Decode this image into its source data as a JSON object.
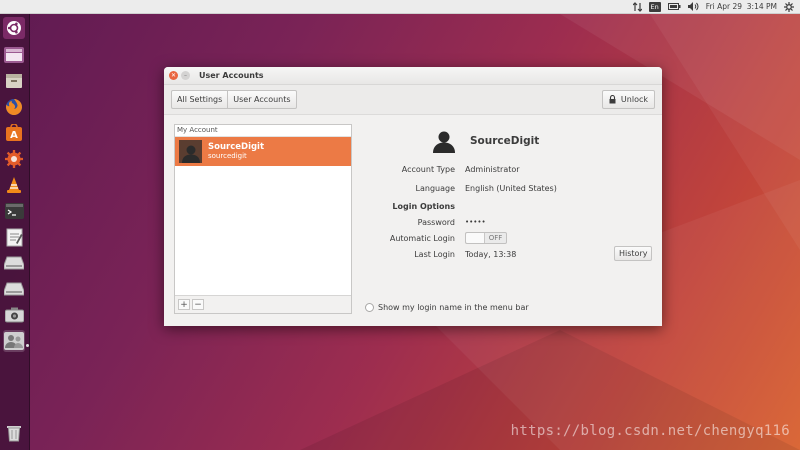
{
  "top_panel": {
    "keyboard_layout": "En",
    "datetime": "Fri Apr 29  3:14 PM",
    "icons": [
      "network-arrows-icon",
      "keyboard-icon",
      "battery-icon",
      "volume-icon",
      "gear-icon"
    ]
  },
  "launcher": {
    "items": [
      "ubuntu-dash-icon",
      "files-manager-icon",
      "archive-icon",
      "firefox-icon",
      "software-center-icon",
      "system-settings-icon",
      "vlc-icon",
      "terminal-icon",
      "text-editor-icon",
      "drive-icon",
      "drive-icon",
      "camera-icon",
      "user-accounts-icon",
      "trash-icon"
    ]
  },
  "window": {
    "title": "User Accounts",
    "toolbar": {
      "all_settings": "All Settings",
      "user_accounts": "User Accounts",
      "unlock": "Unlock"
    },
    "account_list": {
      "header": "My Account",
      "items": [
        {
          "name": "SourceDigit",
          "username": "sourcedigit"
        }
      ],
      "add": "+",
      "remove": "−"
    },
    "details": {
      "name": "SourceDigit",
      "account_type_label": "Account Type",
      "account_type_value": "Administrator",
      "language_label": "Language",
      "language_value": "English (United States)",
      "login_options_label": "Login Options",
      "password_label": "Password",
      "password_value": "•••••",
      "auto_login_label": "Automatic Login",
      "auto_login_state": "OFF",
      "last_login_label": "Last Login",
      "last_login_value": "Today, 13:38",
      "history_button": "History",
      "show_login_name": "Show my login name in the menu bar"
    }
  },
  "watermark": "https://blog.csdn.net/chengyq116",
  "colors": {
    "accent": "#ec7a45",
    "launcher_bg": "#46143c",
    "close_button": "#e9653f"
  }
}
